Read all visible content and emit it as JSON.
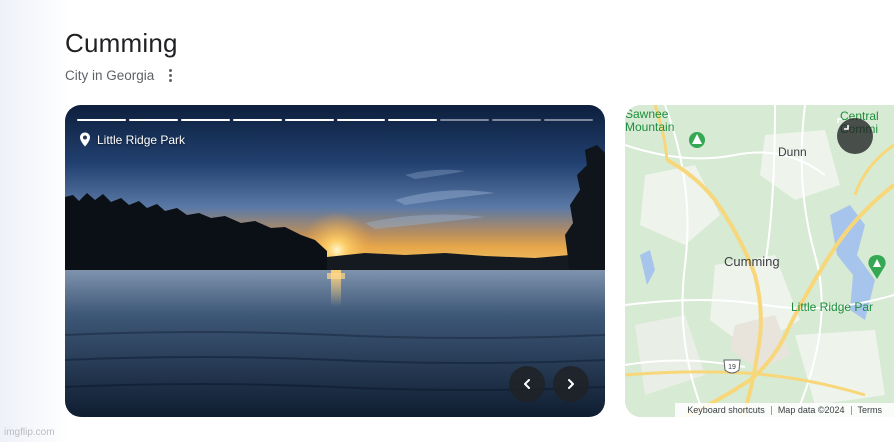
{
  "header": {
    "title": "Cumming",
    "subtitle": "City in Georgia"
  },
  "photo": {
    "location_label": "Little Ridge Park",
    "progress_total": 10,
    "progress_completed": 7
  },
  "map": {
    "labels": {
      "sawnee": "Sawnee\nMountain",
      "dunn": "Dunn",
      "cumming": "Cumming",
      "little_ridge": "Little Ridge Par",
      "central": "Central\nCommi"
    },
    "route_shield": "19",
    "footer": {
      "keyboard_shortcuts": "Keyboard shortcuts",
      "map_data": "Map data ©2024",
      "terms": "Terms"
    }
  },
  "watermark": "imgflip.com",
  "icons": {
    "more": "more-vert-icon",
    "pin": "location-pin-icon",
    "prev": "chevron-left-icon",
    "next": "chevron-right-icon",
    "expand": "expand-icon",
    "poi": "park-marker-icon"
  }
}
